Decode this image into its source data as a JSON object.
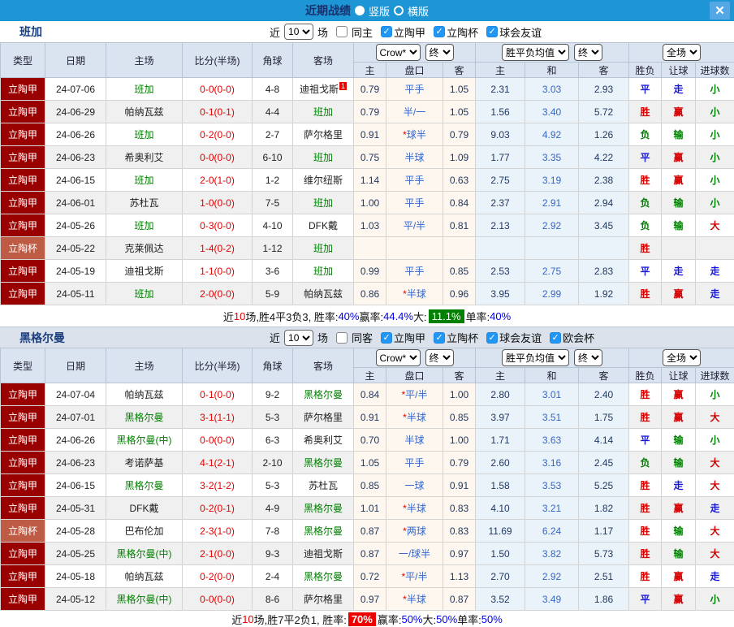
{
  "titlebar": {
    "title": "近期战绩",
    "radios": [
      {
        "label": "竖版",
        "selected": true
      },
      {
        "label": "横版",
        "selected": false
      }
    ],
    "close_glyph": "✕"
  },
  "colors": {
    "topbar_blue": "#1E96D5",
    "header_bg": "#DAE3F0",
    "league_red": "#990000",
    "cup_red": "#BE5B45",
    "score_red": "#E60000",
    "focus_team_green": "#008000",
    "odds_navy": "#1F3864",
    "draw_odds_blue": "#3366CC",
    "handicap_warm_bg": "#FDF7F0",
    "odds_cool_bg": "#EAF3FA",
    "win_red": "#D60000",
    "draw_blue": "#1A1AD6",
    "lose_green": "#008000",
    "highlight_green": "#018001",
    "highlight_red": "#EE0000"
  },
  "columns": {
    "headers": [
      "类型",
      "日期",
      "主场",
      "比分(半场)",
      "角球",
      "客场"
    ],
    "subheaders": [
      "主",
      "盘口",
      "客",
      "主",
      "和",
      "客",
      "胜负",
      "让球",
      "进球数"
    ],
    "selects": [
      "Crow*",
      "终",
      "胜平负均值",
      "终",
      "全场"
    ]
  },
  "sections": [
    {
      "team": "班加",
      "filter": {
        "prefix": "近",
        "count": "10",
        "suffix": "场",
        "same_label": "同主",
        "same_checked": false,
        "comps": [
          "立陶甲",
          "立陶杯",
          "球会友谊"
        ]
      },
      "rows": [
        {
          "type": "立陶甲",
          "cup": false,
          "date": "24-07-06",
          "home": "班加",
          "home_focus": true,
          "score": "0-0(0-0)",
          "corner": "4-8",
          "away": "迪祖戈斯",
          "away_focus": false,
          "away_badge": "1",
          "h": "0.79",
          "line": "平手",
          "a": "1.05",
          "w": "2.31",
          "d": "3.03",
          "l": "2.93",
          "res": "平",
          "ah": "走",
          "ou": "小"
        },
        {
          "type": "立陶甲",
          "cup": false,
          "date": "24-06-29",
          "home": "帕纳瓦兹",
          "home_focus": false,
          "score": "0-1(0-1)",
          "corner": "4-4",
          "away": "班加",
          "away_focus": true,
          "away_badge": "",
          "h": "0.79",
          "line": "半/一",
          "a": "1.05",
          "w": "1.56",
          "d": "3.40",
          "l": "5.72",
          "res": "胜",
          "ah": "赢",
          "ou": "小"
        },
        {
          "type": "立陶甲",
          "cup": false,
          "date": "24-06-26",
          "home": "班加",
          "home_focus": true,
          "score": "0-2(0-0)",
          "corner": "2-7",
          "away": "萨尔格里",
          "away_focus": false,
          "away_badge": "",
          "h": "0.91",
          "line": "*球半",
          "a": "0.79",
          "w": "9.03",
          "d": "4.92",
          "l": "1.26",
          "res": "负",
          "ah": "输",
          "ou": "小"
        },
        {
          "type": "立陶甲",
          "cup": false,
          "date": "24-06-23",
          "home": "希奥利艾",
          "home_focus": false,
          "score": "0-0(0-0)",
          "corner": "6-10",
          "away": "班加",
          "away_focus": true,
          "away_badge": "",
          "h": "0.75",
          "line": "半球",
          "a": "1.09",
          "w": "1.77",
          "d": "3.35",
          "l": "4.22",
          "res": "平",
          "ah": "赢",
          "ou": "小"
        },
        {
          "type": "立陶甲",
          "cup": false,
          "date": "24-06-15",
          "home": "班加",
          "home_focus": true,
          "score": "2-0(1-0)",
          "corner": "1-2",
          "away": "维尔纽斯",
          "away_focus": false,
          "away_badge": "",
          "h": "1.14",
          "line": "平手",
          "a": "0.63",
          "w": "2.75",
          "d": "3.19",
          "l": "2.38",
          "res": "胜",
          "ah": "赢",
          "ou": "小"
        },
        {
          "type": "立陶甲",
          "cup": false,
          "date": "24-06-01",
          "home": "苏杜瓦",
          "home_focus": false,
          "score": "1-0(0-0)",
          "corner": "7-5",
          "away": "班加",
          "away_focus": true,
          "away_badge": "",
          "h": "1.00",
          "line": "平手",
          "a": "0.84",
          "w": "2.37",
          "d": "2.91",
          "l": "2.94",
          "res": "负",
          "ah": "输",
          "ou": "小"
        },
        {
          "type": "立陶甲",
          "cup": false,
          "date": "24-05-26",
          "home": "班加",
          "home_focus": true,
          "score": "0-3(0-0)",
          "corner": "4-10",
          "away": "DFK戴",
          "away_focus": false,
          "away_badge": "",
          "h": "1.03",
          "line": "平/半",
          "a": "0.81",
          "w": "2.13",
          "d": "2.92",
          "l": "3.45",
          "res": "负",
          "ah": "输",
          "ou": "大"
        },
        {
          "type": "立陶杯",
          "cup": true,
          "date": "24-05-22",
          "home": "克莱佩达",
          "home_focus": false,
          "score": "1-4(0-2)",
          "corner": "1-12",
          "away": "班加",
          "away_focus": true,
          "away_badge": "",
          "h": "",
          "line": "",
          "a": "",
          "w": "",
          "d": "",
          "l": "",
          "res": "胜",
          "ah": "",
          "ou": ""
        },
        {
          "type": "立陶甲",
          "cup": false,
          "date": "24-05-19",
          "home": "迪祖戈斯",
          "home_focus": false,
          "score": "1-1(0-0)",
          "corner": "3-6",
          "away": "班加",
          "away_focus": true,
          "away_badge": "",
          "h": "0.99",
          "line": "平手",
          "a": "0.85",
          "w": "2.53",
          "d": "2.75",
          "l": "2.83",
          "res": "平",
          "ah": "走",
          "ou": "走"
        },
        {
          "type": "立陶甲",
          "cup": false,
          "date": "24-05-11",
          "home": "班加",
          "home_focus": true,
          "score": "2-0(0-0)",
          "corner": "5-9",
          "away": "帕纳瓦兹",
          "away_focus": false,
          "away_badge": "",
          "h": "0.86",
          "line": "*半球",
          "a": "0.96",
          "w": "3.95",
          "d": "2.99",
          "l": "1.92",
          "res": "胜",
          "ah": "赢",
          "ou": "走"
        }
      ],
      "summary": [
        {
          "t": "近"
        },
        {
          "t": "10",
          "c": "red"
        },
        {
          "t": "场,胜4平3负3, 胜率:"
        },
        {
          "t": "40%",
          "c": "blue"
        },
        {
          "t": " 赢率:"
        },
        {
          "t": "44.4%",
          "c": "blue"
        },
        {
          "t": " 大:"
        },
        {
          "t": "11.1%",
          "c": "greenbox"
        },
        {
          "t": " 单率:"
        },
        {
          "t": "40%",
          "c": "blue"
        }
      ]
    },
    {
      "team": "黑格尔曼",
      "filter": {
        "prefix": "近",
        "count": "10",
        "suffix": "场",
        "same_label": "同客",
        "same_checked": false,
        "comps": [
          "立陶甲",
          "立陶杯",
          "球会友谊",
          "欧会杯"
        ]
      },
      "rows": [
        {
          "type": "立陶甲",
          "cup": false,
          "date": "24-07-04",
          "home": "帕纳瓦兹",
          "home_focus": false,
          "score": "0-1(0-0)",
          "corner": "9-2",
          "away": "黑格尔曼",
          "away_focus": true,
          "away_badge": "",
          "h": "0.84",
          "line": "*平/半",
          "a": "1.00",
          "w": "2.80",
          "d": "3.01",
          "l": "2.40",
          "res": "胜",
          "ah": "赢",
          "ou": "小"
        },
        {
          "type": "立陶甲",
          "cup": false,
          "date": "24-07-01",
          "home": "黑格尔曼",
          "home_focus": true,
          "score": "3-1(1-1)",
          "corner": "5-3",
          "away": "萨尔格里",
          "away_focus": false,
          "away_badge": "",
          "h": "0.91",
          "line": "*半球",
          "a": "0.85",
          "w": "3.97",
          "d": "3.51",
          "l": "1.75",
          "res": "胜",
          "ah": "赢",
          "ou": "大"
        },
        {
          "type": "立陶甲",
          "cup": false,
          "date": "24-06-26",
          "home": "黑格尔曼(中)",
          "home_focus": true,
          "score": "0-0(0-0)",
          "corner": "6-3",
          "away": "希奥利艾",
          "away_focus": false,
          "away_badge": "",
          "h": "0.70",
          "line": "半球",
          "a": "1.00",
          "w": "1.71",
          "d": "3.63",
          "l": "4.14",
          "res": "平",
          "ah": "输",
          "ou": "小"
        },
        {
          "type": "立陶甲",
          "cup": false,
          "date": "24-06-23",
          "home": "考诺萨基",
          "home_focus": false,
          "score": "4-1(2-1)",
          "corner": "2-10",
          "away": "黑格尔曼",
          "away_focus": true,
          "away_badge": "",
          "h": "1.05",
          "line": "平手",
          "a": "0.79",
          "w": "2.60",
          "d": "3.16",
          "l": "2.45",
          "res": "负",
          "ah": "输",
          "ou": "大"
        },
        {
          "type": "立陶甲",
          "cup": false,
          "date": "24-06-15",
          "home": "黑格尔曼",
          "home_focus": true,
          "score": "3-2(1-2)",
          "corner": "5-3",
          "away": "苏杜瓦",
          "away_focus": false,
          "away_badge": "",
          "h": "0.85",
          "line": "一球",
          "a": "0.91",
          "w": "1.58",
          "d": "3.53",
          "l": "5.25",
          "res": "胜",
          "ah": "走",
          "ou": "大"
        },
        {
          "type": "立陶甲",
          "cup": false,
          "date": "24-05-31",
          "home": "DFK戴",
          "home_focus": false,
          "score": "0-2(0-1)",
          "corner": "4-9",
          "away": "黑格尔曼",
          "away_focus": true,
          "away_badge": "",
          "h": "1.01",
          "line": "*半球",
          "a": "0.83",
          "w": "4.10",
          "d": "3.21",
          "l": "1.82",
          "res": "胜",
          "ah": "赢",
          "ou": "走"
        },
        {
          "type": "立陶杯",
          "cup": true,
          "date": "24-05-28",
          "home": "巴布伦加",
          "home_focus": false,
          "score": "2-3(1-0)",
          "corner": "7-8",
          "away": "黑格尔曼",
          "away_focus": true,
          "away_badge": "",
          "h": "0.87",
          "line": "*两球",
          "a": "0.83",
          "w": "11.69",
          "d": "6.24",
          "l": "1.17",
          "res": "胜",
          "ah": "输",
          "ou": "大"
        },
        {
          "type": "立陶甲",
          "cup": false,
          "date": "24-05-25",
          "home": "黑格尔曼(中)",
          "home_focus": true,
          "score": "2-1(0-0)",
          "corner": "9-3",
          "away": "迪祖戈斯",
          "away_focus": false,
          "away_badge": "",
          "h": "0.87",
          "line": "一/球半",
          "a": "0.97",
          "w": "1.50",
          "d": "3.82",
          "l": "5.73",
          "res": "胜",
          "ah": "输",
          "ou": "大"
        },
        {
          "type": "立陶甲",
          "cup": false,
          "date": "24-05-18",
          "home": "帕纳瓦兹",
          "home_focus": false,
          "score": "0-2(0-0)",
          "corner": "2-4",
          "away": "黑格尔曼",
          "away_focus": true,
          "away_badge": "",
          "h": "0.72",
          "line": "*平/半",
          "a": "1.13",
          "w": "2.70",
          "d": "2.92",
          "l": "2.51",
          "res": "胜",
          "ah": "赢",
          "ou": "走"
        },
        {
          "type": "立陶甲",
          "cup": false,
          "date": "24-05-12",
          "home": "黑格尔曼(中)",
          "home_focus": true,
          "score": "0-0(0-0)",
          "corner": "8-6",
          "away": "萨尔格里",
          "away_focus": false,
          "away_badge": "",
          "h": "0.97",
          "line": "*半球",
          "a": "0.87",
          "w": "3.52",
          "d": "3.49",
          "l": "1.86",
          "res": "平",
          "ah": "赢",
          "ou": "小"
        }
      ],
      "summary": [
        {
          "t": "近"
        },
        {
          "t": "10",
          "c": "red"
        },
        {
          "t": "场,胜7平2负1, 胜率:"
        },
        {
          "t": "70%",
          "c": "redbox"
        },
        {
          "t": " 赢率:"
        },
        {
          "t": "50%",
          "c": "blue"
        },
        {
          "t": " 大:"
        },
        {
          "t": "50%",
          "c": "blue"
        },
        {
          "t": " 单率:"
        },
        {
          "t": "50%",
          "c": "blue"
        }
      ]
    }
  ]
}
